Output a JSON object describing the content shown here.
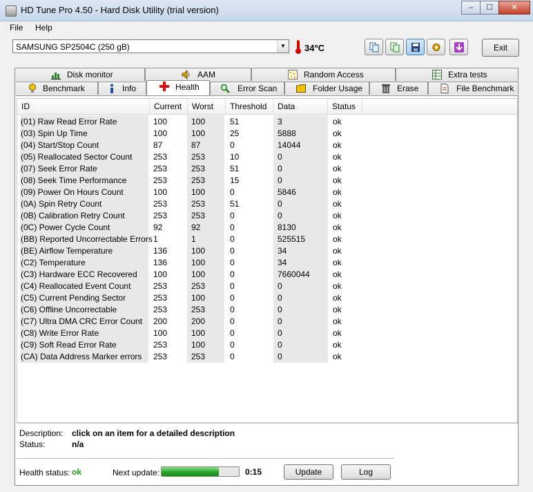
{
  "window": {
    "title": "HD Tune Pro 4.50 - Hard Disk Utility (trial version)",
    "minimize": "–",
    "maximize": "☐",
    "close": "✕"
  },
  "menu": {
    "file": "File",
    "help": "Help"
  },
  "toolbar": {
    "drive": "SAMSUNG SP2504C (250 gB)",
    "temperature": "34°C",
    "exit_label": "Exit"
  },
  "tabs_top": [
    {
      "label": "Disk monitor",
      "icon": "chart-icon"
    },
    {
      "label": "AAM",
      "icon": "speaker-icon"
    },
    {
      "label": "Random Access",
      "icon": "dots-icon"
    },
    {
      "label": "Extra tests",
      "icon": "table-icon"
    }
  ],
  "tabs_bottom": [
    {
      "label": "Benchmark",
      "icon": "bulb-icon"
    },
    {
      "label": "Info",
      "icon": "info-icon"
    },
    {
      "label": "Health",
      "icon": "red-cross-icon"
    },
    {
      "label": "Error Scan",
      "icon": "magnifier-icon"
    },
    {
      "label": "Folder Usage",
      "icon": "folder-icon"
    },
    {
      "label": "Erase",
      "icon": "trash-icon"
    },
    {
      "label": "File Benchmark",
      "icon": "file-icon"
    }
  ],
  "table": {
    "columns": [
      "ID",
      "Current",
      "Worst",
      "Threshold",
      "Data",
      "Status"
    ],
    "rows": [
      [
        "(01) Raw Read Error Rate",
        "100",
        "100",
        "51",
        "3",
        "ok"
      ],
      [
        "(03) Spin Up Time",
        "100",
        "100",
        "25",
        "5888",
        "ok"
      ],
      [
        "(04) Start/Stop Count",
        "87",
        "87",
        "0",
        "14044",
        "ok"
      ],
      [
        "(05) Reallocated Sector Count",
        "253",
        "253",
        "10",
        "0",
        "ok"
      ],
      [
        "(07) Seek Error Rate",
        "253",
        "253",
        "51",
        "0",
        "ok"
      ],
      [
        "(08) Seek Time Performance",
        "253",
        "253",
        "15",
        "0",
        "ok"
      ],
      [
        "(09) Power On Hours Count",
        "100",
        "100",
        "0",
        "5846",
        "ok"
      ],
      [
        "(0A) Spin Retry Count",
        "253",
        "253",
        "51",
        "0",
        "ok"
      ],
      [
        "(0B) Calibration Retry Count",
        "253",
        "253",
        "0",
        "0",
        "ok"
      ],
      [
        "(0C) Power Cycle Count",
        "92",
        "92",
        "0",
        "8130",
        "ok"
      ],
      [
        "(BB) Reported Uncorrectable Errors",
        "1",
        "1",
        "0",
        "525515",
        "ok"
      ],
      [
        "(BE) Airflow Temperature",
        "136",
        "100",
        "0",
        "34",
        "ok"
      ],
      [
        "(C2) Temperature",
        "136",
        "100",
        "0",
        "34",
        "ok"
      ],
      [
        "(C3) Hardware ECC Recovered",
        "100",
        "100",
        "0",
        "7660044",
        "ok"
      ],
      [
        "(C4) Reallocated Event Count",
        "253",
        "253",
        "0",
        "0",
        "ok"
      ],
      [
        "(C5) Current Pending Sector",
        "253",
        "100",
        "0",
        "0",
        "ok"
      ],
      [
        "(C6) Offline Uncorrectable",
        "253",
        "253",
        "0",
        "0",
        "ok"
      ],
      [
        "(C7) Ultra DMA CRC Error Count",
        "200",
        "200",
        "0",
        "0",
        "ok"
      ],
      [
        "(C8) Write Error Rate",
        "100",
        "100",
        "0",
        "0",
        "ok"
      ],
      [
        "(C9) Soft Read Error Rate",
        "253",
        "100",
        "0",
        "0",
        "ok"
      ],
      [
        "(CA) Data Address Marker errors",
        "253",
        "253",
        "0",
        "0",
        "ok"
      ]
    ]
  },
  "details": {
    "description_label": "Description:",
    "description_value": "click on an item for a detailed description",
    "status_label": "Status:",
    "status_value": "n/a"
  },
  "footer": {
    "health_label": "Health status:",
    "health_value": "ok",
    "next_update_label": "Next update:",
    "progress_percent": 74,
    "countdown": "0:15",
    "update_label": "Update",
    "log_label": "Log"
  },
  "colors": {
    "ok_green": "#22a022",
    "progress_green": "#2aa52a",
    "thermometer_red": "#d60000"
  }
}
